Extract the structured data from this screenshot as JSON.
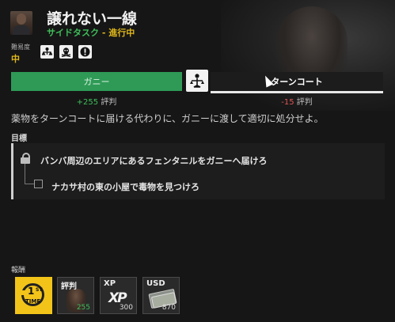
{
  "quest": {
    "title": "譲れない一線",
    "type": "サイドタスク",
    "separator": " - ",
    "status": "進行中"
  },
  "difficulty": {
    "label": "難易度",
    "value": "中"
  },
  "choice": {
    "left_faction": "ガニー",
    "right_faction": "ターンコート",
    "left_rep_value": "+255",
    "right_rep_value": "-15",
    "rep_word": "評判"
  },
  "description": "薬物をターンコートに届ける代わりに、ガニーに渡して適切に処分せよ。",
  "objectives": {
    "heading": "目標",
    "items": [
      "バンバ周辺のエリアにあるフェンタニルをガニーへ届けろ",
      "ナカサ村の東の小屋で毒物を見つけろ"
    ]
  },
  "rewards": {
    "heading": "報酬",
    "first_time_number": "1",
    "first_time_suffix": "ST",
    "first_time_word": "TIME",
    "reputation_label": "評判",
    "reputation_value": "255",
    "xp_label": "XP",
    "xp_icon_text": "XP",
    "xp_value": "300",
    "usd_label": "USD",
    "usd_value": "870"
  },
  "colors": {
    "accent_green": "#2e9a56",
    "status_yellow": "#e0b81a",
    "negative_red": "#e25555"
  }
}
